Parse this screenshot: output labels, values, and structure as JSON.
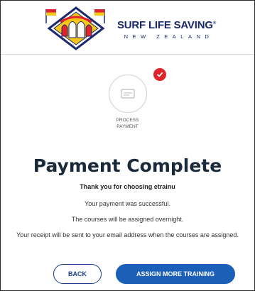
{
  "brand": {
    "name": "SURF LIFE SAVING",
    "registered_mark": "®",
    "country": "NEW ZEALAND",
    "colors": {
      "navy": "#1a2a6c",
      "red": "#e0242b",
      "yellow": "#f5c518"
    }
  },
  "progress": {
    "step_label_line1": "PROCESS",
    "step_label_line2": "PAYMENT",
    "step_icon": "payment-card-icon",
    "status_icon": "checkmark-icon",
    "status_color": "#e0242b",
    "completed": true
  },
  "confirmation": {
    "title": "Payment Complete",
    "thanks": "Thank you for choosing etrainu",
    "line1": "Your payment was successful.",
    "line2": "The courses will be assigned overnight.",
    "line3": "Your receipt will be sent to your email address when the courses are assigned."
  },
  "actions": {
    "back_label": "BACK",
    "assign_label": "ASSIGN MORE TRAINING",
    "primary_color": "#1b5fb8"
  }
}
